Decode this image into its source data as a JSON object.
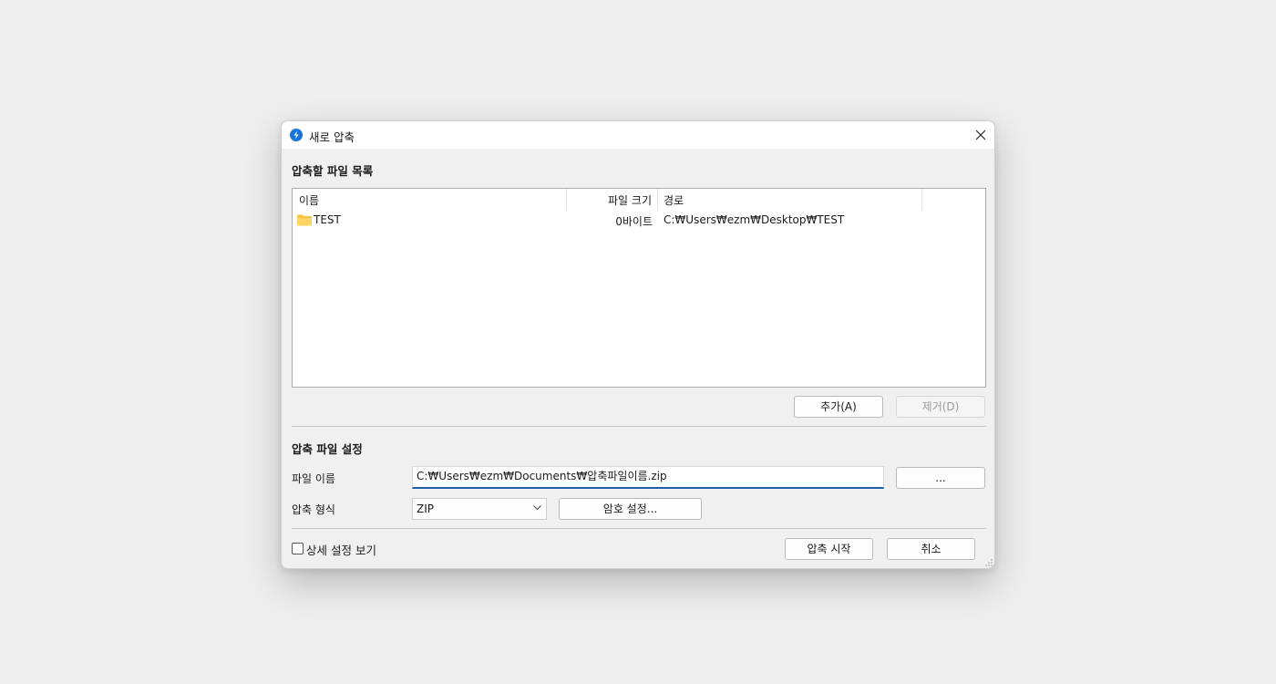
{
  "window": {
    "title": "새로 압축",
    "icon": "app-logo-icon",
    "close_icon": "close-icon",
    "accent": "#1877d6"
  },
  "file_list": {
    "section_title": "압축할 파일 목록",
    "columns": [
      "이름",
      "파일 크기",
      "경로"
    ],
    "rows": [
      {
        "icon": "folder-icon",
        "name": "TEST",
        "size": "0바이트",
        "path": "C:₩Users₩ezm₩Desktop₩TEST"
      }
    ],
    "add_button": "추가(A)",
    "remove_button": "제거(D)"
  },
  "settings": {
    "section_title": "압축 파일 설정",
    "filename_label": "파일 이름",
    "filename_value": "C:₩Users₩ezm₩Documents₩압축파일이름.zip",
    "browse_button": "...",
    "format_label": "압축 형식",
    "format_value": "ZIP",
    "password_button": "암호 설정..."
  },
  "footer": {
    "advanced_checkbox_label": "상세 설정 보기",
    "advanced_checked": false,
    "start_button": "압축 시작",
    "cancel_button": "취소"
  }
}
